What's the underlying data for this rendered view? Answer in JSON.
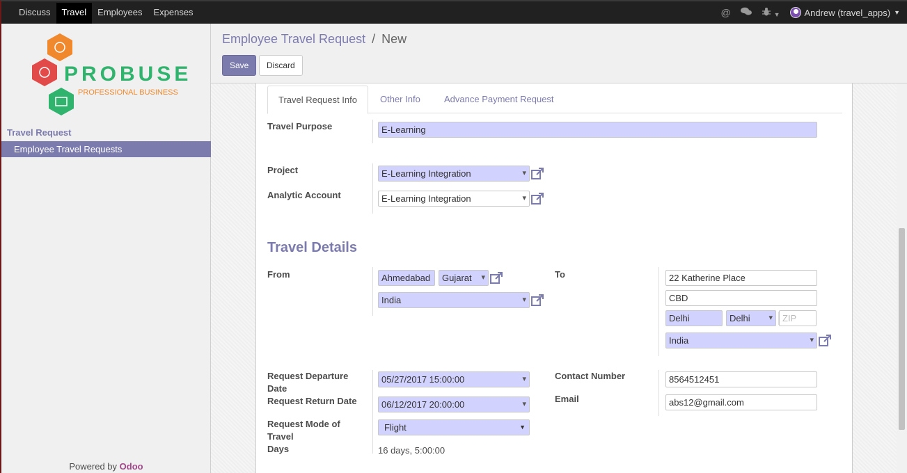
{
  "topbar": {
    "menu": [
      "Discuss",
      "Travel",
      "Employees",
      "Expenses"
    ],
    "active_index": 1,
    "icons": [
      "at-icon",
      "chat-icon",
      "bug-icon"
    ],
    "user": "Andrew (travel_apps)"
  },
  "sidebar": {
    "logo_text": "PROBUSE",
    "logo_tagline": "PROFESSIONAL BUSINESS",
    "section_title": "Travel Request",
    "item": "Employee Travel Requests",
    "powered_by": "Powered by",
    "powered_brand": "Odoo"
  },
  "control_panel": {
    "breadcrumb_parent": "Employee Travel Request",
    "breadcrumb_sep": "/",
    "breadcrumb_current": "New",
    "save_label": "Save",
    "discard_label": "Discard"
  },
  "tabs": [
    "Travel Request Info",
    "Other Info",
    "Advance Payment Request"
  ],
  "form": {
    "travel_purpose_label": "Travel Purpose",
    "travel_purpose_value": "E-Learning",
    "project_label": "Project",
    "project_value": "E-Learning Integration",
    "analytic_label": "Analytic Account",
    "analytic_value": "E-Learning Integration",
    "travel_details_title": "Travel Details",
    "from_label": "From",
    "from_city": "Ahmedabad",
    "from_state": "Gujarat",
    "from_country": "India",
    "to_label": "To",
    "to_street": "22 Katherine Place",
    "to_street2": "CBD",
    "to_city": "Delhi",
    "to_state": "Delhi",
    "to_zip_placeholder": "ZIP",
    "to_country": "India",
    "departure_label": "Request Departure Date",
    "departure_value": "05/27/2017 15:00:00",
    "return_label": "Request Return Date",
    "return_value": "06/12/2017 20:00:00",
    "mode_label": "Request Mode of Travel",
    "mode_value": "Flight",
    "days_label": "Days",
    "days_value": "16 days, 5:00:00",
    "contact_label": "Contact Number",
    "contact_value": "8564512451",
    "email_label": "Email",
    "email_value": "abs12@gmail.com"
  }
}
